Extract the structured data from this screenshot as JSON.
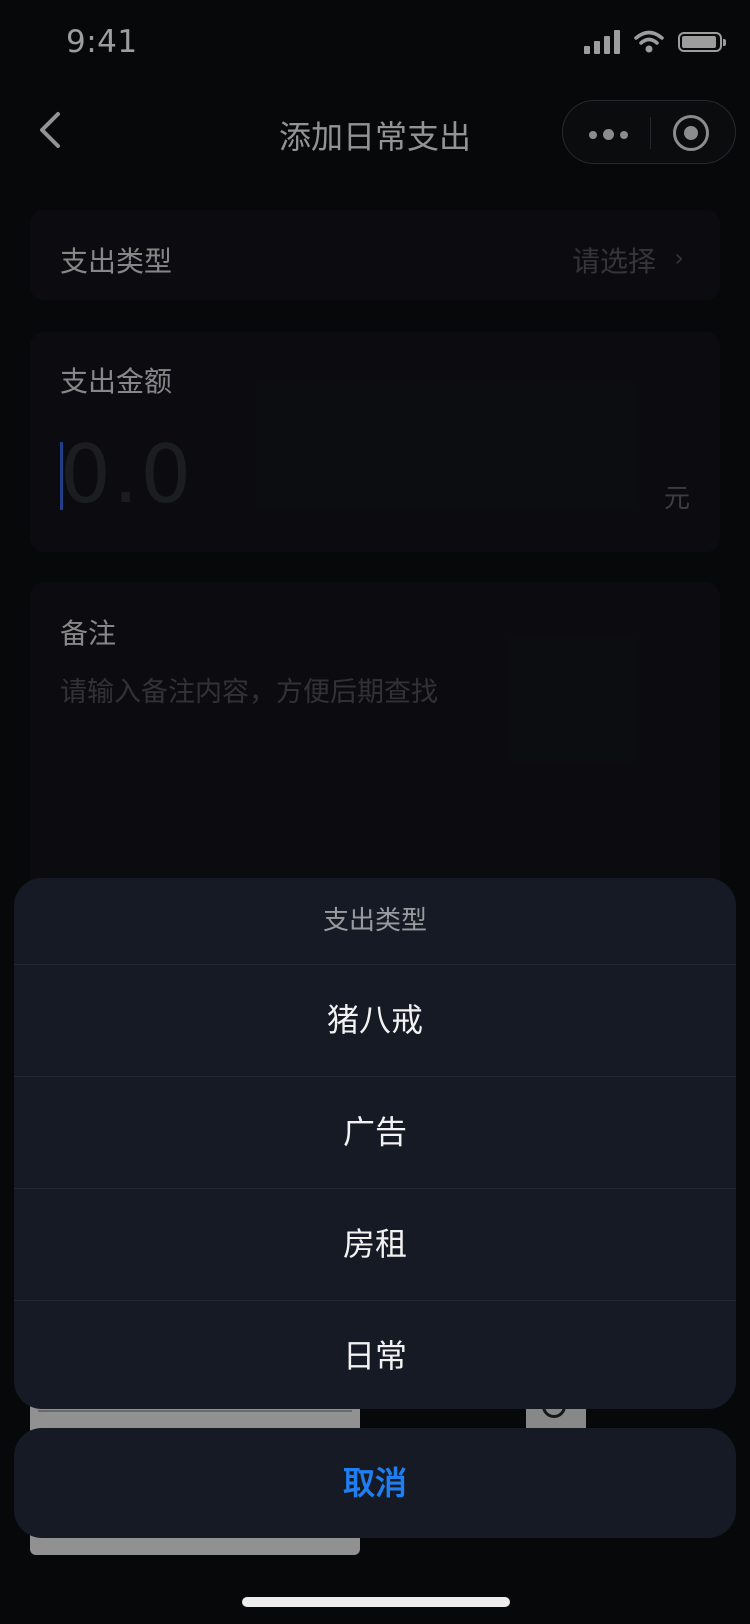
{
  "status_bar": {
    "time": "9:41"
  },
  "nav": {
    "title": "添加日常支出"
  },
  "form": {
    "type_label": "支出类型",
    "type_value_placeholder": "请选择",
    "amount_label": "支出金额",
    "amount_placeholder": "0.0",
    "amount_unit": "元",
    "remark_label": "备注",
    "remark_placeholder": "请输入备注内容，方便后期查找"
  },
  "action_sheet": {
    "title": "支出类型",
    "options": [
      "猪八戒",
      "广告",
      "房租",
      "日常"
    ],
    "cancel_label": "取消"
  },
  "colors": {
    "background": "#0b0c10",
    "sheet": "#161a24",
    "accent": "#1f7ef0"
  },
  "icons": [
    "back-arrow-icon",
    "more-dots-icon",
    "target-close-icon",
    "chevron-right-icon",
    "signal-icon",
    "wifi-icon",
    "battery-icon"
  ]
}
